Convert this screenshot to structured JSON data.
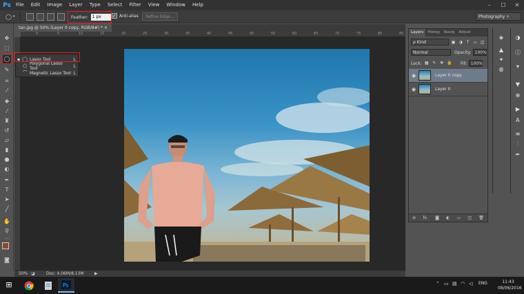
{
  "app": {
    "logo": "Ps",
    "menu": [
      "File",
      "Edit",
      "Image",
      "Layer",
      "Type",
      "Select",
      "Filter",
      "View",
      "Window",
      "Help"
    ],
    "window_controls": [
      "–",
      "☐",
      "✕"
    ]
  },
  "options_bar": {
    "feather_label": "Feather:",
    "feather_value": "1 px",
    "antialias_label": "Anti-alias",
    "antialias_checked": "✓",
    "refine_edge_label": "Refine Edge...",
    "workspace": "Photography ÷"
  },
  "document": {
    "tab_title": "tan.jpg @ 50% (Layer 0 copy, RGB/8#) * ×",
    "ruler_ticks": [
      "0",
      "5",
      "10",
      "15",
      "20",
      "25",
      "30",
      "35",
      "40",
      "45",
      "50",
      "55",
      "60",
      "65",
      "70",
      "75",
      "80",
      "85"
    ]
  },
  "lasso_flyout": {
    "items": [
      {
        "bullet": "▪",
        "icon": "lasso",
        "label": "Lasso Tool",
        "key": "L"
      },
      {
        "bullet": "",
        "icon": "polygonal-lasso",
        "label": "Polygonal Lasso Tool",
        "key": "L"
      },
      {
        "bullet": "",
        "icon": "magnetic-lasso",
        "label": "Magnetic Lasso Tool",
        "key": "L"
      }
    ]
  },
  "status": {
    "zoom": "50%",
    "doc_info": "Doc: 4.06M/8.13M",
    "arrow": "▶"
  },
  "layers_panel": {
    "tabs": [
      "Layers",
      "Histog",
      "Navig",
      "Adjust"
    ],
    "kind_filter": "ρ Kind",
    "blend_mode": "Normal",
    "opacity_label": "Opacity:",
    "opacity_value": "100%",
    "lock_label": "Lock:",
    "fill_label": "Fill:",
    "fill_value": "100%",
    "layers": [
      {
        "name": "Layer 0 copy",
        "selected": true
      },
      {
        "name": "Layer 0",
        "selected": false
      }
    ],
    "footer_icons": [
      "⊖",
      "fx.",
      "◙",
      "◐",
      "▭",
      "◫",
      "🗑"
    ]
  },
  "taskbar": {
    "start": "⊞",
    "tray_lang": "ENG",
    "time": "11:43",
    "date": "08/06/2016"
  },
  "colors": {
    "accent_red": "#e02020",
    "foreground_swatch": "#8a4a2e",
    "background_swatch": "#ffffff"
  }
}
